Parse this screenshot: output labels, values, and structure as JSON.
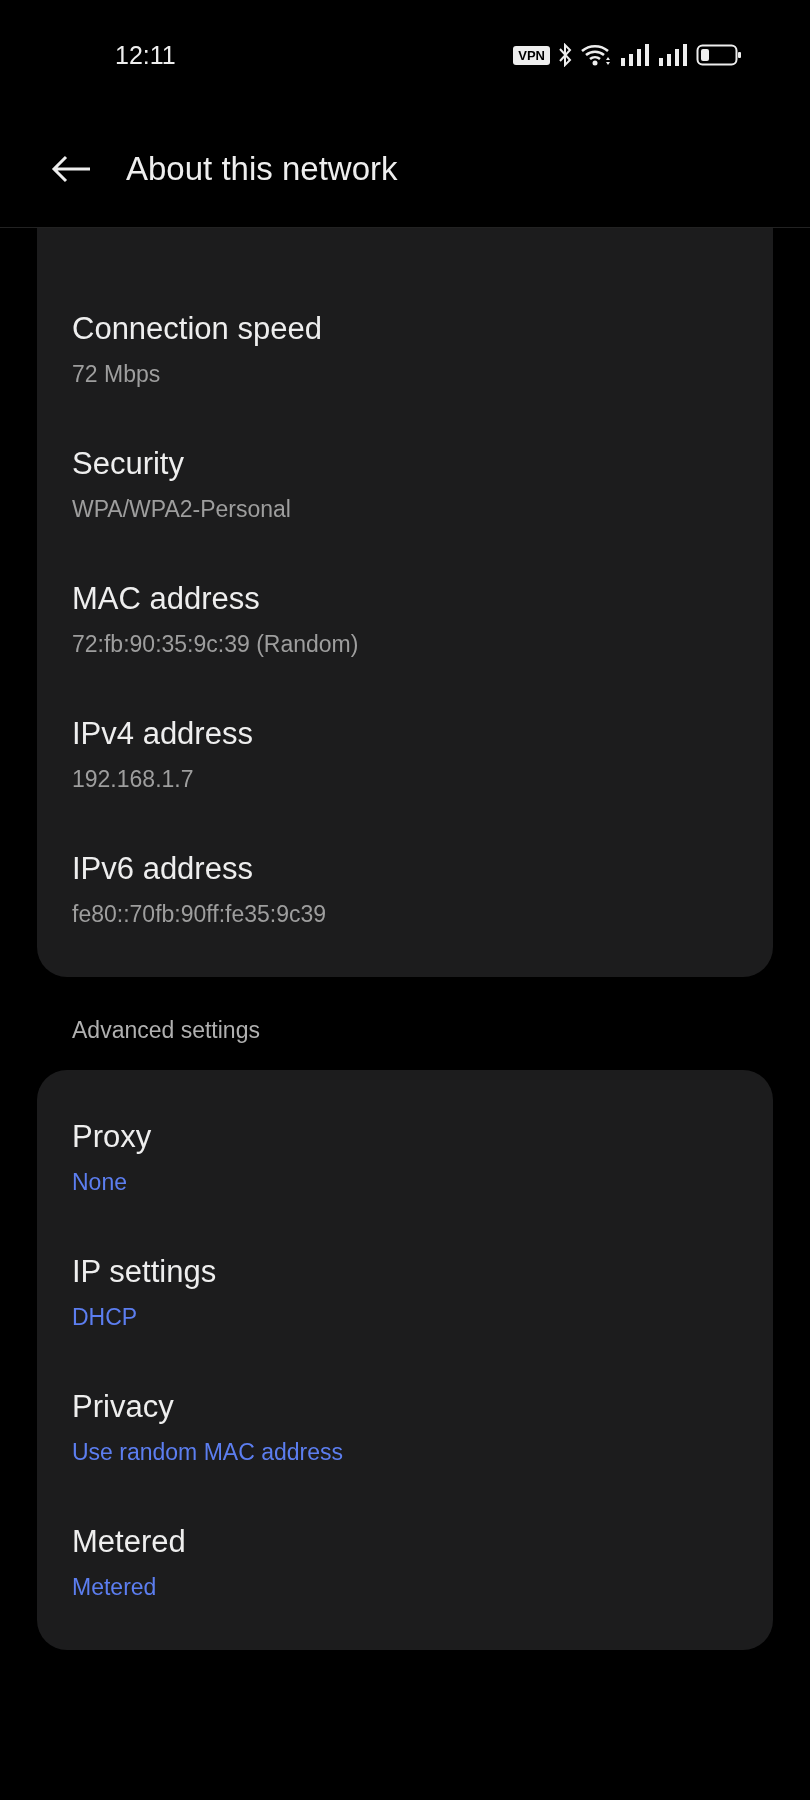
{
  "status_bar": {
    "time": "12:11",
    "vpn_badge": "VPN"
  },
  "header": {
    "title": "About this network"
  },
  "sections": [
    {
      "items": [
        {
          "title": "Connection speed",
          "value": "72 Mbps",
          "kind": "info"
        },
        {
          "title": "Security",
          "value": "WPA/WPA2-Personal",
          "kind": "info"
        },
        {
          "title": "MAC address",
          "value": "72:fb:90:35:9c:39 (Random)",
          "kind": "info"
        },
        {
          "title": "IPv4 address",
          "value": "192.168.1.7",
          "kind": "info"
        },
        {
          "title": "IPv6 address",
          "value": "fe80::70fb:90ff:fe35:9c39",
          "kind": "info"
        }
      ]
    },
    {
      "heading": "Advanced settings",
      "items": [
        {
          "title": "Proxy",
          "value": "None",
          "kind": "setting"
        },
        {
          "title": "IP settings",
          "value": "DHCP",
          "kind": "setting"
        },
        {
          "title": "Privacy",
          "value": "Use random MAC address",
          "kind": "setting"
        },
        {
          "title": "Metered",
          "value": "Metered",
          "kind": "setting"
        }
      ]
    }
  ]
}
